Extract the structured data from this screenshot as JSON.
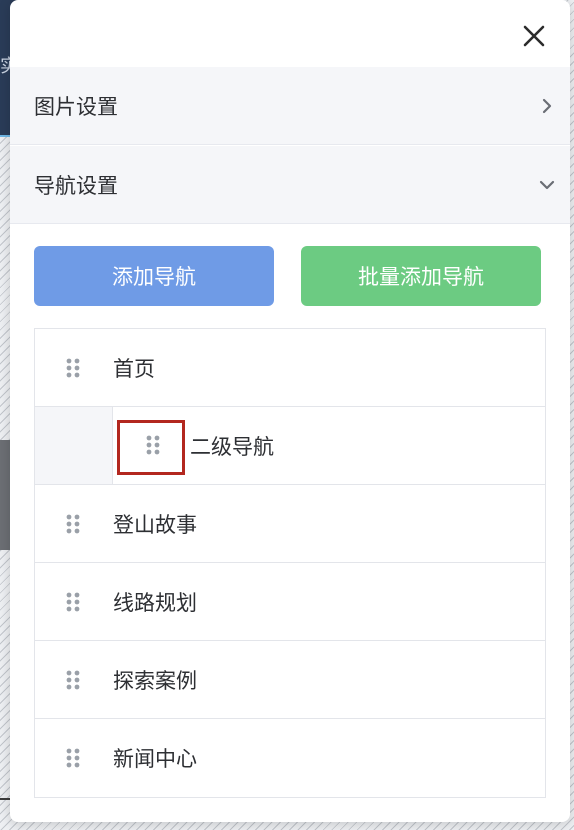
{
  "background": {
    "partial_text": "实"
  },
  "panel": {
    "close_icon": "close-icon"
  },
  "sections": [
    {
      "label": "图片设置",
      "state": "collapsed"
    },
    {
      "label": "导航设置",
      "state": "expanded"
    }
  ],
  "buttons": {
    "add_nav": "添加导航",
    "batch_add_nav": "批量添加导航"
  },
  "nav_items": [
    {
      "label": "首页",
      "level": 1
    },
    {
      "label": "二级导航",
      "level": 2,
      "highlighted_handle": true
    },
    {
      "label": "登山故事",
      "level": 1
    },
    {
      "label": "线路规划",
      "level": 1
    },
    {
      "label": "探索案例",
      "level": 1
    },
    {
      "label": "新闻中心",
      "level": 1
    }
  ],
  "colors": {
    "add_button": "#6f9be6",
    "batch_button": "#6ccb82",
    "highlight_border": "#b3271f",
    "section_bg": "#f5f6f9"
  }
}
